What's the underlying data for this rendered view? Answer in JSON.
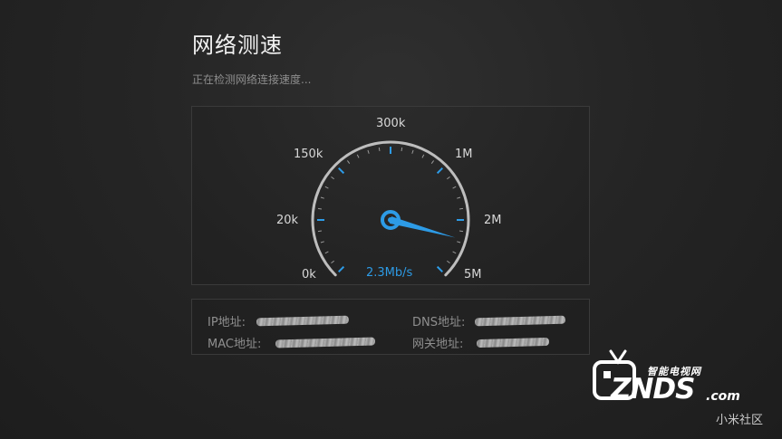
{
  "header": {
    "title": "网络测速",
    "status_text": "正在检测网络连接速度..."
  },
  "speedometer": {
    "tick_labels": [
      "0k",
      "20k",
      "150k",
      "300k",
      "1M",
      "2M",
      "5M"
    ],
    "current_speed": "2.3Mb/s",
    "needle_level_fraction": 0.89,
    "accent_color": "#2d9be6"
  },
  "network_info": {
    "ip_label": "IP地址:",
    "dns_label": "DNS地址:",
    "mac_label": "MAC地址:",
    "gateway_label": "网关地址:"
  },
  "watermark": {
    "tagline": "智能电视网",
    "brand": "ZNDS",
    "domain": ".com",
    "icon": "tv-logo-icon"
  },
  "footer": {
    "community": "小米社区"
  }
}
